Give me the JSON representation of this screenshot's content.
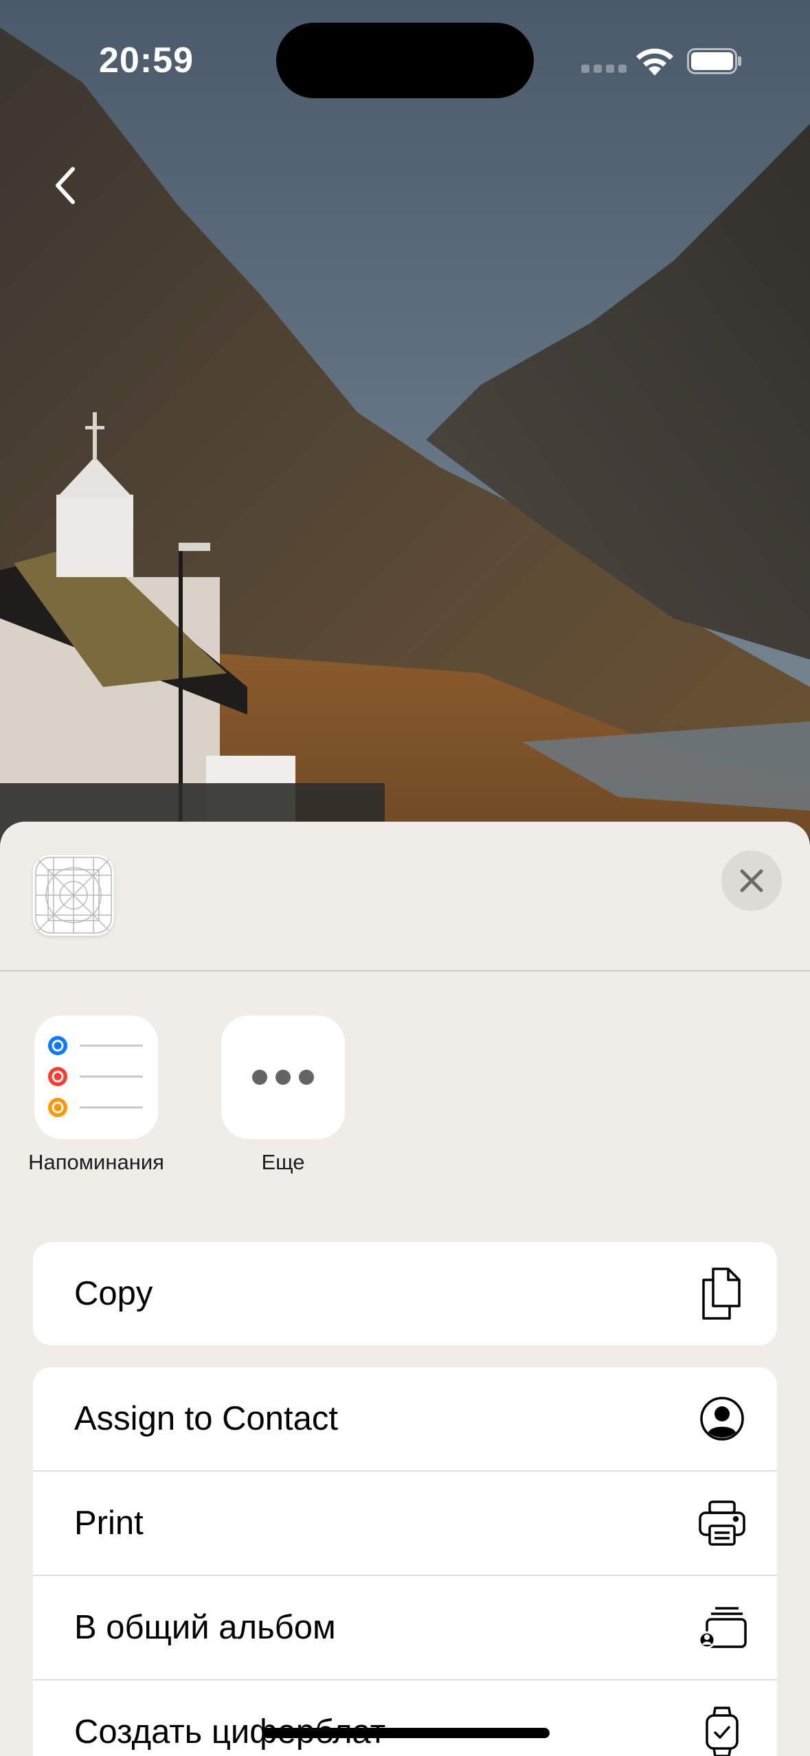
{
  "status_bar": {
    "time": "20:59"
  },
  "nav": {
    "back_icon": "chevron-left-icon"
  },
  "share_sheet": {
    "close_icon": "xmark-icon",
    "apps": [
      {
        "label": "Напоминания",
        "icon": "reminders-app-icon"
      },
      {
        "label": "Еще",
        "icon": "more-ellipsis-icon"
      }
    ],
    "actions_primary": [
      {
        "label": "Copy",
        "icon": "copy-document-icon"
      }
    ],
    "actions_secondary": [
      {
        "label": "Assign to Contact",
        "icon": "person-circle-icon"
      },
      {
        "label": "Print",
        "icon": "printer-icon"
      },
      {
        "label": "В общий альбом",
        "icon": "shared-album-icon"
      },
      {
        "label": "Создать циферблат",
        "icon": "watch-face-icon"
      }
    ]
  },
  "colors": {
    "sheet_background": "#f0ede9",
    "reminder_blue": "#0a7aff",
    "reminder_red": "#ff3b30",
    "reminder_orange": "#ff9500"
  }
}
